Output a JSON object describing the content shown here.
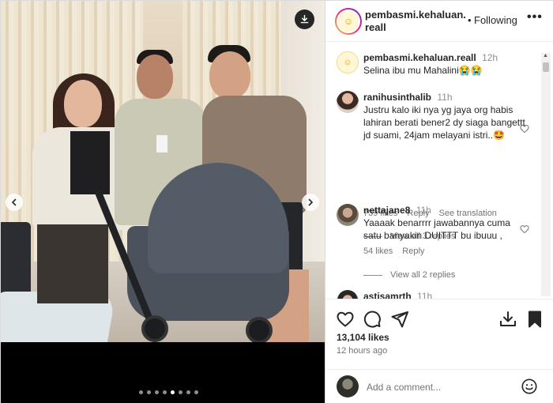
{
  "post": {
    "username": "pembasmi.kehaluan.reall",
    "follow_separator": "•",
    "follow_status": "Following",
    "more": "•••",
    "carousel": {
      "total": 8,
      "active_index": 4
    }
  },
  "comments": [
    {
      "username": "pembasmi.kehaluan.reall",
      "time": "12h",
      "text": "Selina ibu mu Mahalini😭😭",
      "is_caption": true
    },
    {
      "username": "ranihusinthalib",
      "time": "11h",
      "text": "Justru kalo iki nya yg jaya org habis lahiran berati bener2 dy siaga bangettt jd suami, 24jam melayani istri..🤩",
      "likes": "739 likes",
      "reply": "Reply",
      "translate": "See translation",
      "view_replies": "View all 3 replies"
    },
    {
      "username": "nettajane8",
      "time": "11h",
      "text": "Yaaaak benarrrr jawabannya cuma satu banyakin DUITTT bu ibuuu ,",
      "likes": "54 likes",
      "reply": "Reply",
      "view_replies": "View all 2 replies"
    },
    {
      "username": "astisamrth",
      "time": "11h"
    }
  ],
  "stats": {
    "likes": "13,104 likes",
    "time_ago": "12 hours ago"
  },
  "add_comment": {
    "placeholder": "Add a comment..."
  },
  "colors": {
    "text": "#262626",
    "muted": "#737373",
    "border": "#dbdbdb"
  }
}
